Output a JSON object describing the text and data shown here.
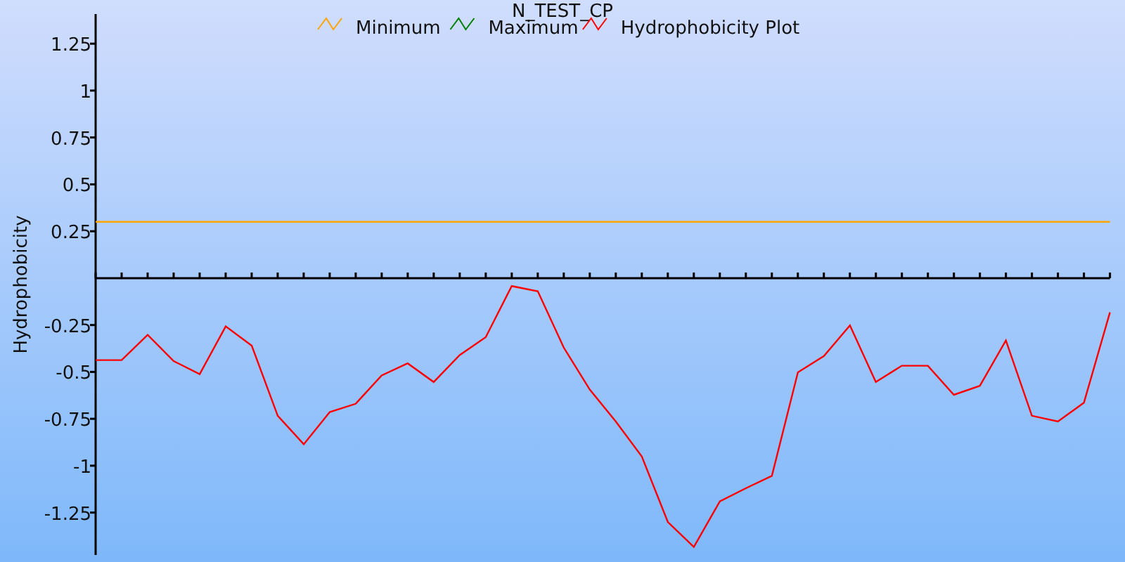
{
  "chart_data": {
    "type": "line",
    "title": "N_TEST_CP",
    "ylabel": "Hydrophobicity",
    "categories": [
      null,
      null,
      null,
      null,
      null,
      null,
      null,
      null,
      null,
      null,
      null,
      null,
      null,
      null,
      null,
      null,
      null,
      null,
      null,
      null,
      null,
      null,
      null,
      null,
      null,
      null,
      null,
      null,
      null,
      null,
      null,
      null,
      null,
      null,
      null,
      null,
      null,
      null,
      null,
      null
    ],
    "series": [
      {
        "name": "Minimum",
        "color": "#ffa500",
        "values": [
          0.3,
          0.3,
          0.3,
          0.3,
          0.3,
          0.3,
          0.3,
          0.3,
          0.3,
          0.3,
          0.3,
          0.3,
          0.3,
          0.3,
          0.3,
          0.3,
          0.3,
          0.3,
          0.3,
          0.3,
          0.3,
          0.3,
          0.3,
          0.3,
          0.3,
          0.3,
          0.3,
          0.3,
          0.3,
          0.3,
          0.3,
          0.3,
          0.3,
          0.3,
          0.3,
          0.3,
          0.3,
          0.3,
          0.3,
          0.3
        ]
      },
      {
        "name": "Maximum",
        "color": "#008000",
        "values": [
          null,
          null,
          null,
          null,
          null,
          null,
          null,
          null,
          null,
          null,
          null,
          null,
          null,
          null,
          null,
          null,
          null,
          null,
          null,
          null,
          null,
          null,
          null,
          null,
          null,
          null,
          null,
          null,
          null,
          null,
          null,
          null,
          null,
          null,
          null,
          null,
          null,
          null,
          null,
          null
        ]
      },
      {
        "name": "Hydrophobicity Plot",
        "color": "#ff0000",
        "values": [
          -0.437,
          -0.437,
          -0.302,
          -0.442,
          -0.512,
          -0.257,
          -0.36,
          -0.734,
          -0.886,
          -0.714,
          -0.67,
          -0.519,
          -0.454,
          -0.554,
          -0.41,
          -0.315,
          -0.042,
          -0.07,
          -0.37,
          -0.594,
          -0.764,
          -0.951,
          -1.3,
          -1.433,
          -1.19,
          -1.12,
          -1.054,
          -0.502,
          -0.415,
          -0.252,
          -0.554,
          -0.467,
          -0.467,
          -0.622,
          -0.574,
          -0.332,
          -0.734,
          -0.764,
          -0.664,
          -0.182
        ]
      }
    ],
    "legend": "top",
    "ylim": [
      -1.476,
      1.408
    ],
    "yticks": [
      {
        "value": -1.25,
        "label": "-1.25"
      },
      {
        "value": -1,
        "label": "-1"
      },
      {
        "value": -0.75,
        "label": "-0.75"
      },
      {
        "value": -0.5,
        "label": "-0.5"
      },
      {
        "value": -0.25,
        "label": "-0.25"
      },
      {
        "value": 0.25,
        "label": "0.25"
      },
      {
        "value": 0.5,
        "label": "0.5"
      },
      {
        "value": 0.75,
        "label": "0.75"
      },
      {
        "value": 1,
        "label": "1"
      },
      {
        "value": 1.25,
        "label": "1.25"
      }
    ]
  }
}
